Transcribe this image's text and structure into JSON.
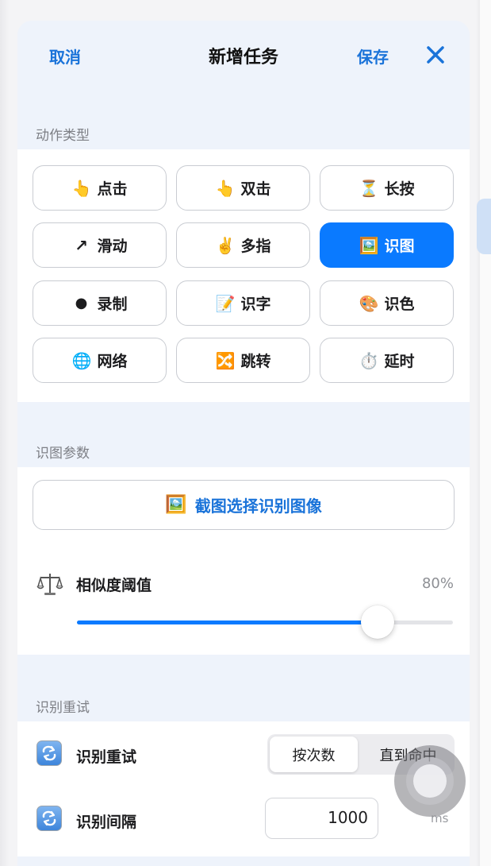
{
  "header": {
    "cancel_label": "取消",
    "title": "新增任务",
    "save_label": "保存"
  },
  "action_section": {
    "label": "动作类型",
    "actions": [
      {
        "glyph": "👆",
        "label": "点击",
        "selected": false
      },
      {
        "glyph": "👆",
        "label": "双击",
        "selected": false
      },
      {
        "glyph": "⏳",
        "label": "长按",
        "selected": false
      },
      {
        "glyph": "↗",
        "label": "滑动",
        "selected": false
      },
      {
        "glyph": "✌️",
        "label": "多指",
        "selected": false
      },
      {
        "glyph": "🖼️",
        "label": "识图",
        "selected": true
      },
      {
        "glyph": "●",
        "label": "录制",
        "selected": false
      },
      {
        "glyph": "📝",
        "label": "识字",
        "selected": false
      },
      {
        "glyph": "🎨",
        "label": "识色",
        "selected": false
      },
      {
        "glyph": "🌐",
        "label": "网络",
        "selected": false
      },
      {
        "glyph": "🔀",
        "label": "跳转",
        "selected": false
      },
      {
        "glyph": "⏱️",
        "label": "延时",
        "selected": false
      }
    ]
  },
  "image_section": {
    "label": "识图参数",
    "capture_button": {
      "glyph": "🖼️",
      "label": "截图选择识别图像"
    },
    "similarity": {
      "icon": "scale-icon",
      "label": "相似度阈值",
      "value_text": "80%",
      "value": 0.8
    }
  },
  "retry_section": {
    "label": "识别重试",
    "retry_row": {
      "label": "识别重试",
      "options": [
        "按次数",
        "直到命中"
      ],
      "selected_index": 0
    },
    "interval_row": {
      "label": "识别间隔",
      "value": "1000",
      "unit": "ms"
    }
  },
  "colors": {
    "accent": "#0a7aff",
    "link": "#1a73d9",
    "sheet_bg": "#eef3fb"
  }
}
